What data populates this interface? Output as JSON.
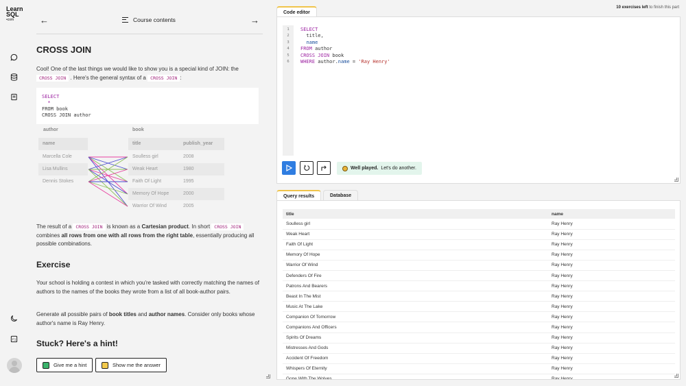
{
  "brand": {
    "line1": "Learn",
    "line2": "SQL",
    "line3": "•com"
  },
  "nav": {
    "center": "Course contents"
  },
  "lesson": {
    "title": "CROSS JOIN",
    "intro_a": "Cool! One of the last things we would like to show you is a special kind of JOIN: the",
    "intro_code": "CROSS JOIN",
    "intro_b": ". Here's the general syntax of a",
    "intro_code2": "CROSS JOIN",
    "intro_c": ":",
    "code_lines": [
      "SELECT",
      "  *",
      "FROM book",
      "CROSS JOIN author"
    ],
    "diagram": {
      "left_title": "author",
      "left_header": "name",
      "left_rows": [
        "Marcella Cole",
        "Lisa Mullins",
        "Dennis Stokes"
      ],
      "right_title": "book",
      "right_headers": [
        "title",
        "publish_year"
      ],
      "right_rows": [
        [
          "Soulless girl",
          "2008"
        ],
        [
          "Weak Heart",
          "1980"
        ],
        [
          "Faith Of Light",
          "1995"
        ],
        [
          "Memory Of Hope",
          "2000"
        ],
        [
          "Warrior Of Wind",
          "2005"
        ]
      ],
      "link_colors": [
        "#e83fa0",
        "#4a4ad0",
        "#8ec05a"
      ]
    },
    "result_a": "The result of a",
    "result_code": "CROSS JOIN",
    "result_b": "is known as a",
    "result_bold": "Cartesian product",
    "result_c": ". In short",
    "result_code2": "CROSS JOIN",
    "result_d": "combines",
    "result_bold2": "all rows from one with all rows from the right table",
    "result_e": ", essentially producing all possible combinations.",
    "exercise_title": "Exercise",
    "exercise_p1": "Your school is holding a contest in which you're tasked with correctly matching the names of authors to the names of the books they wrote from a list of all book-author pairs.",
    "exercise_p2_a": "Generate all possible pairs of",
    "exercise_p2_b1": "book titles",
    "exercise_p2_and": "and",
    "exercise_p2_b2": "author names",
    "exercise_p2_c": ". Consider only books whose author's name is Ray Henry.",
    "hint_title": "Stuck? Here's a hint!",
    "hint_button": "Give me a hint",
    "answer_button": "Show me the answer"
  },
  "editor": {
    "tab": "Code editor",
    "exercises_left_bold": "10 exercises left",
    "exercises_left_rest": "to finish this part",
    "line_numbers": [
      "1",
      "2",
      "3",
      "4",
      "5",
      "6"
    ],
    "success_bold": "Well played.",
    "success_rest": "Let's do another.",
    "accent": "#2f7de1"
  },
  "results": {
    "tabs": [
      "Query results",
      "Database"
    ],
    "columns": [
      "title",
      "name"
    ],
    "rows": [
      [
        "Soulless girl",
        "Ray Henry"
      ],
      [
        "Weak Heart",
        "Ray Henry"
      ],
      [
        "Faith Of Light",
        "Ray Henry"
      ],
      [
        "Memory Of Hope",
        "Ray Henry"
      ],
      [
        "Warrior Of Wind",
        "Ray Henry"
      ],
      [
        "Defenders Of Fire",
        "Ray Henry"
      ],
      [
        "Patrons And Bearers",
        "Ray Henry"
      ],
      [
        "Beast In The Mist",
        "Ray Henry"
      ],
      [
        "Music At The Lake",
        "Ray Henry"
      ],
      [
        "Companion Of Tomorrow",
        "Ray Henry"
      ],
      [
        "Companions And Officers",
        "Ray Henry"
      ],
      [
        "Spirits Of Dreams",
        "Ray Henry"
      ],
      [
        "Mistresses And Gods",
        "Ray Henry"
      ],
      [
        "Accident Of Freedom",
        "Ray Henry"
      ],
      [
        "Whispers Of Eternity",
        "Ray Henry"
      ],
      [
        "Gone With The Wolves",
        "Ray Henry"
      ]
    ]
  }
}
